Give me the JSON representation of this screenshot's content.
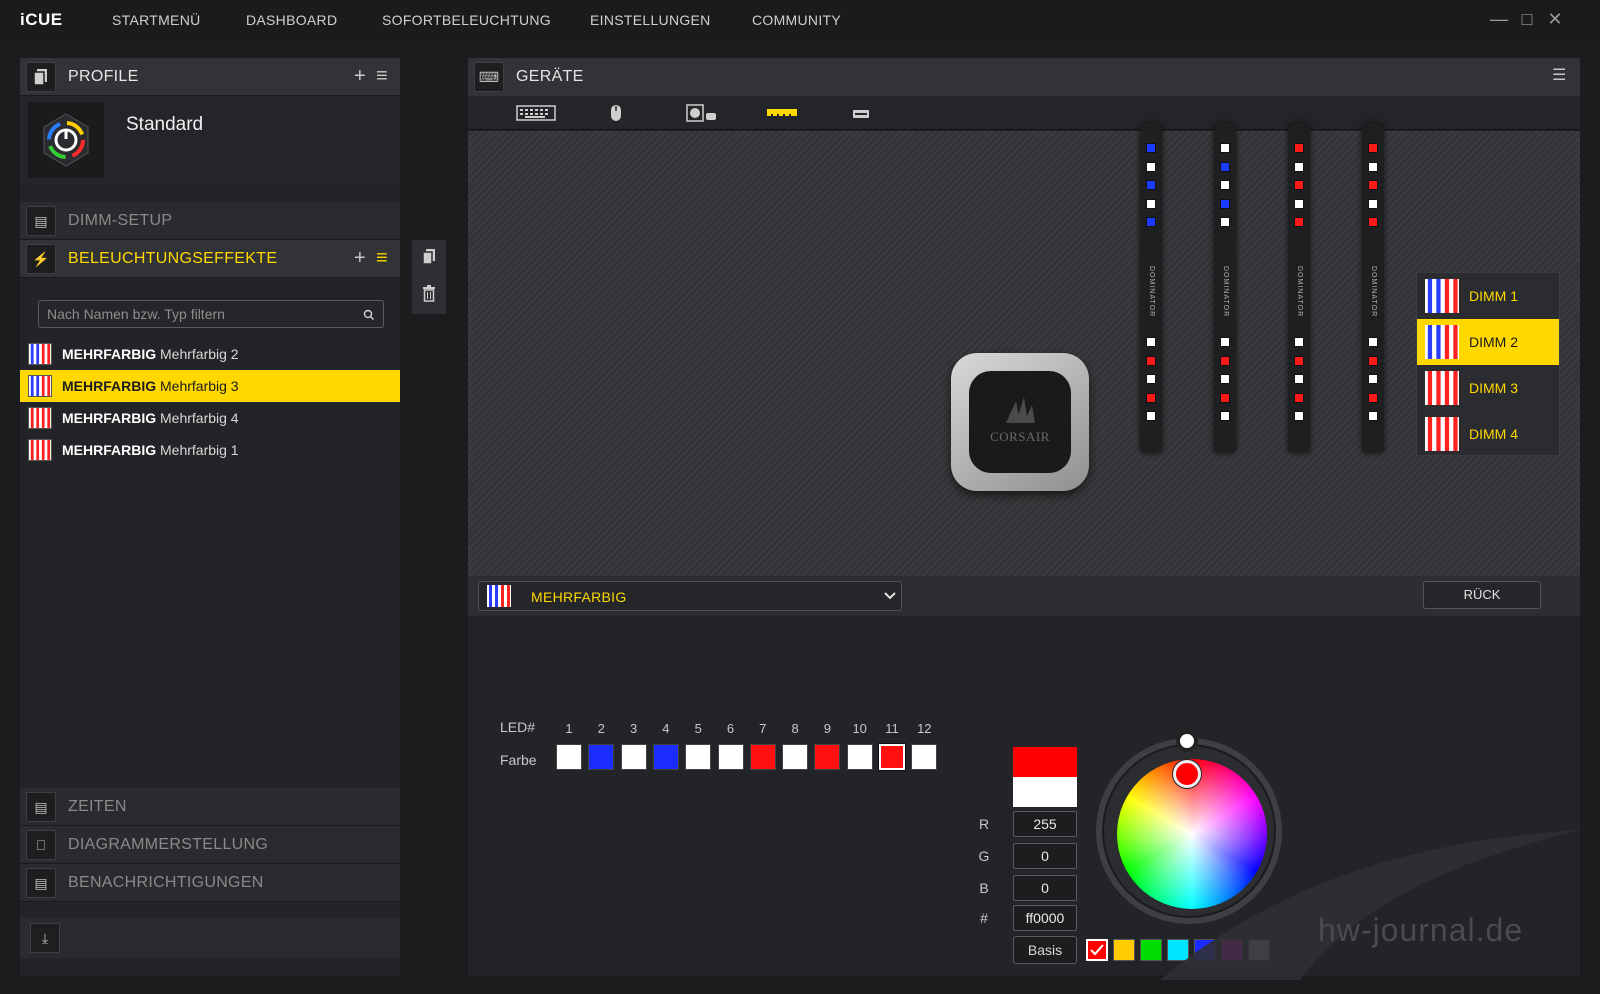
{
  "app": {
    "name": "iCUE"
  },
  "nav": [
    "STARTMENÜ",
    "DASHBOARD",
    "SOFORTBELEUCHTUNG",
    "EINSTELLUNGEN",
    "COMMUNITY"
  ],
  "profiles": {
    "title": "PROFILE",
    "current": "Standard"
  },
  "sections": {
    "dimm_setup": "DIMM-SETUP",
    "lighting": "BELEUCHTUNGSEFFEKTE",
    "timers": "ZEITEN",
    "graphs": "DIAGRAMMERSTELLUNG",
    "notifications": "BENACHRICHTIGUNGEN"
  },
  "filter": {
    "placeholder": "Nach Namen bzw. Typ filtern"
  },
  "effects": [
    {
      "type": "MEHRFARBIG",
      "name": "Mehrfarbig 2",
      "selected": false,
      "icon": "stripes-blue-white-red"
    },
    {
      "type": "MEHRFARBIG",
      "name": "Mehrfarbig 3",
      "selected": true,
      "icon": "stripes-blue-white-red"
    },
    {
      "type": "MEHRFARBIG",
      "name": "Mehrfarbig 4",
      "selected": false,
      "icon": "stripes-red-white"
    },
    {
      "type": "MEHRFARBIG",
      "name": "Mehrfarbig 1",
      "selected": false,
      "icon": "stripes-red-white"
    }
  ],
  "devices": {
    "title": "GERÄTE",
    "tabs": [
      "keyboard-icon",
      "mouse-icon",
      "cooler-icon",
      "memory-icon",
      "headset-stand-icon"
    ],
    "active_tab": 3
  },
  "pump_brand": "CORSAIR",
  "dimm_brand": "DOMINATOR",
  "dimm_modules": [
    {
      "leds_top": [
        "#1a3cff",
        "#ffffff",
        "#1a3cff",
        "#ffffff",
        "#1a3cff"
      ],
      "leds_bottom": [
        "#ffffff",
        "#ff1a1a",
        "#ffffff",
        "#ff1a1a",
        "#ffffff"
      ]
    },
    {
      "leds_top": [
        "#ffffff",
        "#1a3cff",
        "#ffffff",
        "#1a3cff",
        "#ffffff"
      ],
      "leds_bottom": [
        "#ffffff",
        "#ff1a1a",
        "#ffffff",
        "#ff1a1a",
        "#ffffff"
      ]
    },
    {
      "leds_top": [
        "#ff1a1a",
        "#ffffff",
        "#ff1a1a",
        "#ffffff",
        "#ff1a1a"
      ],
      "leds_bottom": [
        "#ffffff",
        "#ff1a1a",
        "#ffffff",
        "#ff1a1a",
        "#ffffff"
      ]
    },
    {
      "leds_top": [
        "#ff1a1a",
        "#ffffff",
        "#ff1a1a",
        "#ffffff",
        "#ff1a1a"
      ],
      "leds_bottom": [
        "#ffffff",
        "#ff1a1a",
        "#ffffff",
        "#ff1a1a",
        "#ffffff"
      ]
    }
  ],
  "dimm_list": [
    {
      "label": "DIMM 1",
      "selected": false,
      "icon": "stripes-blue-white-red"
    },
    {
      "label": "DIMM 2",
      "selected": true,
      "icon": "stripes-blue-white-red"
    },
    {
      "label": "DIMM 3",
      "selected": false,
      "icon": "stripes-red-white"
    },
    {
      "label": "DIMM 4",
      "selected": false,
      "icon": "stripes-red-white"
    }
  ],
  "effect_select": {
    "value": "MEHRFARBIG"
  },
  "back_button": "RÜCK",
  "led_editor": {
    "led_label": "LED#",
    "color_label": "Farbe",
    "leds": [
      "1",
      "2",
      "3",
      "4",
      "5",
      "6",
      "7",
      "8",
      "9",
      "10",
      "11",
      "12"
    ],
    "colors": [
      "#ffffff",
      "#1a2cff",
      "#ffffff",
      "#1a2cff",
      "#ffffff",
      "#ffffff",
      "#ff1010",
      "#ffffff",
      "#ff1010",
      "#ffffff",
      "#ff1010",
      "#ffffff"
    ],
    "selected_index": 10
  },
  "color": {
    "r_label": "R",
    "g_label": "G",
    "b_label": "B",
    "hex_label": "#",
    "r": "255",
    "g": "0",
    "b": "0",
    "hex": "ff0000",
    "basis": "Basis",
    "new": "#ff0000",
    "old": "#ffffff"
  },
  "presets": [
    "#ff0000",
    "#ffcc00",
    "#00dd00",
    "#00e5ff",
    "#1a2cff",
    "#ff00ff",
    "#d0d4e0"
  ],
  "watermark": "hw-journal.de",
  "colors": {
    "accent": "#ffd800",
    "panel": "#232427",
    "header": "#323336"
  }
}
